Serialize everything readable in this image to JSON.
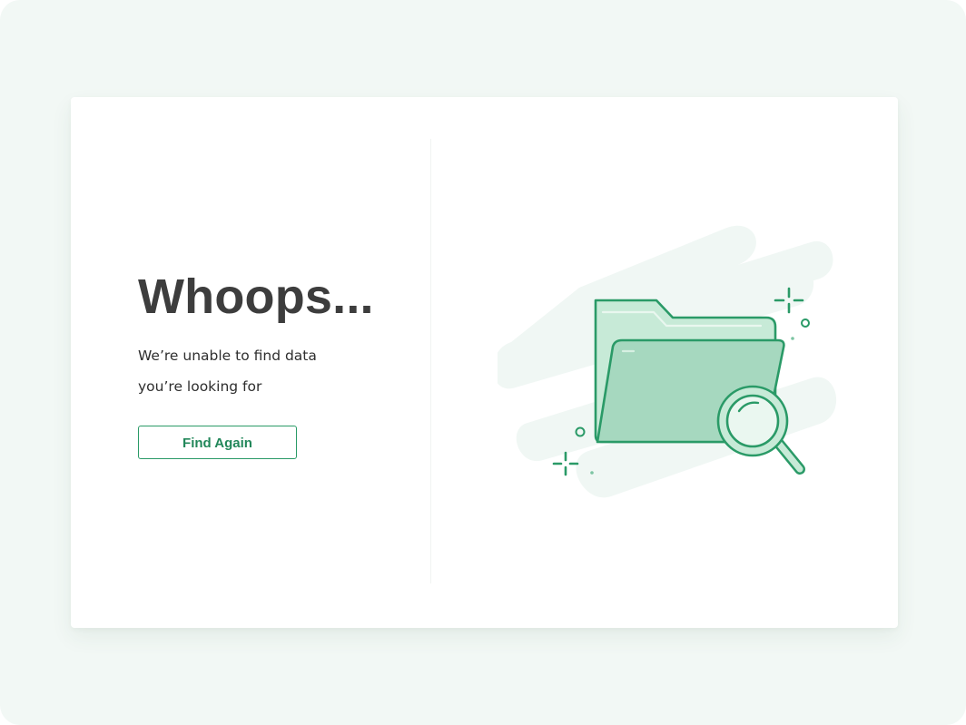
{
  "error": {
    "title": "Whoops...",
    "message": "We’re unable to find data you’re looking for",
    "button_label": "Find Again"
  },
  "illustration": {
    "icons": [
      "folder-icon",
      "magnifier-icon",
      "sparkle-icon",
      "circle-icon"
    ]
  },
  "colors": {
    "page_background": "#f2f8f5",
    "card_background": "#ffffff",
    "accent": "#2a9a67",
    "title_text": "#3d3d3d",
    "illustration_fill": "#a6d8bf",
    "illustration_stroke": "#2a9a67",
    "blob": "#f0f7f4"
  }
}
